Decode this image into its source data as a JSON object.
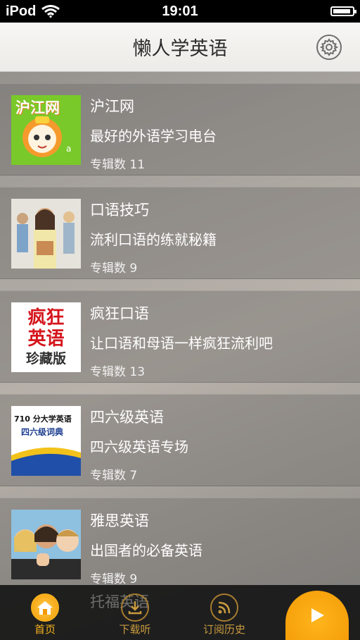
{
  "status_bar": {
    "carrier": "iPod",
    "time": "19:01"
  },
  "header": {
    "title": "懒人学英语",
    "settings_icon": "gear-icon"
  },
  "albums": [
    {
      "title": "沪江网",
      "description": "最好的外语学习电台",
      "count": "专辑数 11",
      "thumb_text": "沪江网"
    },
    {
      "title": "口语技巧",
      "description": "流利口语的练就秘籍",
      "count": "专辑数 9"
    },
    {
      "title": "疯狂口语",
      "description": "让口语和母语一样疯狂流利吧",
      "count": "专辑数 13",
      "thumb_lines": [
        "疯狂",
        "英语",
        "珍藏版"
      ]
    },
    {
      "title": "四六级英语",
      "description": "四六级英语专场",
      "count": "专辑数 7",
      "thumb_lines": [
        "710 分大学英语",
        "四六级词典"
      ]
    },
    {
      "title": "雅思英语",
      "description": "出国者的必备英语",
      "count": "专辑数 9"
    }
  ],
  "peek_item": {
    "title": "托福英语"
  },
  "tabs": [
    {
      "label": "首页",
      "icon": "home-icon",
      "active": true
    },
    {
      "label": "下载听",
      "icon": "download-icon",
      "active": false
    },
    {
      "label": "订阅历史",
      "icon": "rss-icon",
      "active": false
    }
  ],
  "player": {
    "icon": "play-icon"
  },
  "colors": {
    "accent": "#f6b21c",
    "tab_bg": "#161616",
    "nav_bg": "#f2f1ee"
  }
}
